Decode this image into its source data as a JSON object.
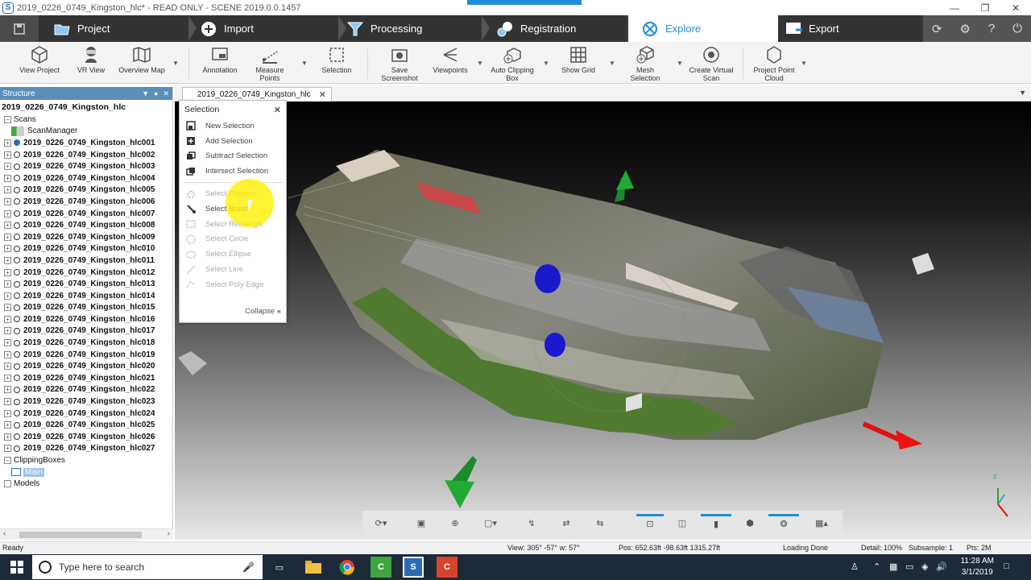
{
  "window": {
    "title": "2019_0226_0749_Kingston_hlc* - READ ONLY - SCENE 2019.0.0.1457",
    "app_icon": "S"
  },
  "tabs": [
    {
      "label": "Project",
      "icon": "folder-icon"
    },
    {
      "label": "Import",
      "icon": "import-icon"
    },
    {
      "label": "Processing",
      "icon": "funnel-icon"
    },
    {
      "label": "Registration",
      "icon": "registration-icon"
    },
    {
      "label": "Explore",
      "icon": "explore-icon",
      "active": true
    },
    {
      "label": "Export",
      "icon": "export-icon"
    }
  ],
  "ribbon": [
    {
      "label": "View Project",
      "icon": "cube-icon"
    },
    {
      "label": "VR View",
      "icon": "vr-icon"
    },
    {
      "label": "Overview Map",
      "icon": "map-icon"
    },
    {
      "label": "Annotation",
      "icon": "annotation-icon"
    },
    {
      "label": "Measure\nPoints",
      "icon": "measure-icon"
    },
    {
      "label": "Selection",
      "icon": "selection-icon"
    },
    {
      "label": "Save\nScreenshot",
      "icon": "camera-icon"
    },
    {
      "label": "Viewpoints",
      "icon": "viewpoints-icon"
    },
    {
      "label": "Auto Clipping\nBox",
      "icon": "clipping-box-icon"
    },
    {
      "label": "Show Grid",
      "icon": "grid-icon"
    },
    {
      "label": "Mesh\nSelection",
      "icon": "mesh-icon"
    },
    {
      "label": "Create Virtual\nScan",
      "icon": "virtual-scan-icon"
    },
    {
      "label": "Project Point\nCloud",
      "icon": "point-cloud-icon"
    }
  ],
  "structure": {
    "header": "Structure",
    "root": "2019_0226_0749_Kingston_hlc",
    "scans_label": "Scans",
    "scan_manager": "ScanManager",
    "scans": [
      "2019_0226_0749_Kingston_hlc001",
      "2019_0226_0749_Kingston_hlc002",
      "2019_0226_0749_Kingston_hlc003",
      "2019_0226_0749_Kingston_hlc004",
      "2019_0226_0749_Kingston_hlc005",
      "2019_0226_0749_Kingston_hlc006",
      "2019_0226_0749_Kingston_hlc007",
      "2019_0226_0749_Kingston_hlc008",
      "2019_0226_0749_Kingston_hlc009",
      "2019_0226_0749_Kingston_hlc010",
      "2019_0226_0749_Kingston_hlc011",
      "2019_0226_0749_Kingston_hlc012",
      "2019_0226_0749_Kingston_hlc013",
      "2019_0226_0749_Kingston_hlc014",
      "2019_0226_0749_Kingston_hlc015",
      "2019_0226_0749_Kingston_hlc016",
      "2019_0226_0749_Kingston_hlc017",
      "2019_0226_0749_Kingston_hlc018",
      "2019_0226_0749_Kingston_hlc019",
      "2019_0226_0749_Kingston_hlc020",
      "2019_0226_0749_Kingston_hlc021",
      "2019_0226_0749_Kingston_hlc022",
      "2019_0226_0749_Kingston_hlc023",
      "2019_0226_0749_Kingston_hlc024",
      "2019_0226_0749_Kingston_hlc025",
      "2019_0226_0749_Kingston_hlc026",
      "2019_0226_0749_Kingston_hlc027"
    ],
    "clipping_boxes": "ClippingBoxes",
    "main_item": "Main",
    "models": "Models"
  },
  "document_tab": "2019_0226_0749_Kingston_hlc",
  "selection_menu": {
    "title": "Selection",
    "groups": [
      [
        {
          "label": "New Selection",
          "icon": "new-selection-icon"
        },
        {
          "label": "Add Selection",
          "icon": "add-selection-icon"
        },
        {
          "label": "Subtract Selection",
          "icon": "subtract-selection-icon"
        },
        {
          "label": "Intersect Selection",
          "icon": "intersect-selection-icon"
        }
      ],
      [
        {
          "label": "Select Polygon",
          "icon": "polygon-icon"
        },
        {
          "label": "Select Brush",
          "icon": "brush-icon"
        },
        {
          "label": "Select Rectangle",
          "icon": "rectangle-icon"
        },
        {
          "label": "Select Circle",
          "icon": "circle-icon"
        },
        {
          "label": "Select Ellipse",
          "icon": "ellipse-icon"
        },
        {
          "label": "Select Line",
          "icon": "line-icon"
        },
        {
          "label": "Select Poly Edge",
          "icon": "poly-edge-icon"
        }
      ]
    ],
    "collapse": "Collapse"
  },
  "status": {
    "ready": "Ready",
    "view": "View: 305° -57° w: 57°",
    "pos": "Pos: 652.63ft -98.63ft 1315.27ft",
    "loading": "Loading Done",
    "detail": "Detail: 100%",
    "subsample": "Subsample:  1",
    "pts": "Pts:   2M"
  },
  "taskbar": {
    "search_placeholder": "Type here to search",
    "time": "11:28 AM",
    "date": "3/1/2019"
  },
  "colors": {
    "accent": "#1e8fd8",
    "tab_bg": "#3c3c3c",
    "panel_header": "#5b8fb8"
  }
}
